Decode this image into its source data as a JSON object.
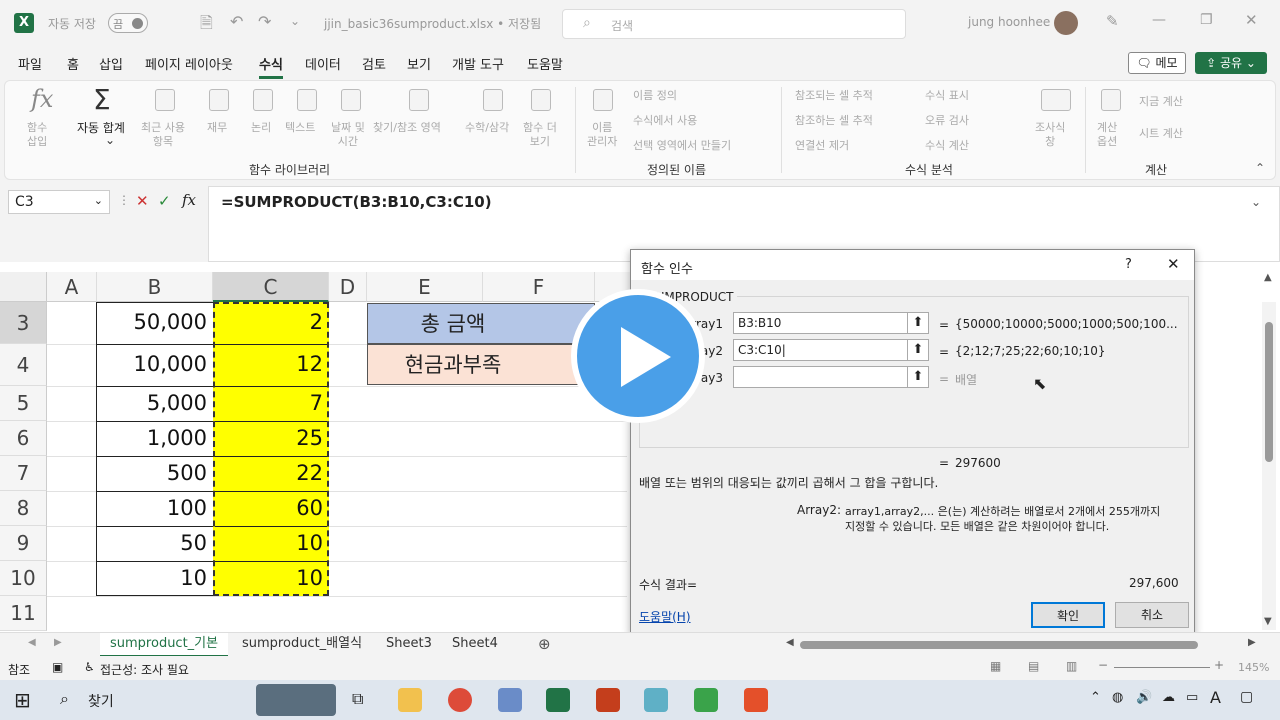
{
  "titlebar": {
    "autosave_label": "자동 저장",
    "autosave_state": "끔",
    "filename": "jjin_basic36sumproduct.xlsx • 저장됨",
    "search_placeholder": "검색",
    "user": "jung hoonhee"
  },
  "menu": [
    "파일",
    "홈",
    "삽입",
    "페이지 레이아웃",
    "수식",
    "데이터",
    "검토",
    "보기",
    "개발 도구",
    "도움말"
  ],
  "menu_active": "수식",
  "buttons": {
    "memo": "메모",
    "share": "공유"
  },
  "ribbon": {
    "func_library": {
      "label": "함수 라이브러리",
      "items": [
        "함수\n삽입",
        "자동 합계",
        "최근 사용\n항목",
        "재무",
        "논리",
        "텍스트",
        "날짜 및\n시간",
        "찾기/참조 영역",
        "수학/삼각",
        "함수 더\n보기"
      ]
    },
    "defined_names": {
      "label": "정의된 이름",
      "manager": "이름\n관리자",
      "items": [
        "이름 정의",
        "수식에서 사용",
        "선택 영역에서 만들기"
      ]
    },
    "auditing": {
      "label": "수식 분석",
      "items": [
        "참조되는 셀 추적",
        "참조하는 셀 추적",
        "연결선 제거",
        "수식 표시",
        "오류 검사",
        "수식 계산"
      ],
      "watch": "조사식\n창"
    },
    "calculation": {
      "label": "계산",
      "options": "계산\n옵션",
      "items": [
        "지금 계산",
        "시트 계산"
      ]
    }
  },
  "formula_bar": {
    "name_box": "C3",
    "formula": "=SUMPRODUCT(B3:B10,C3:C10)"
  },
  "columns": [
    "A",
    "B",
    "C",
    "D",
    "E",
    "F"
  ],
  "rows": [
    "3",
    "4",
    "5",
    "6",
    "7",
    "8",
    "9",
    "10",
    "11"
  ],
  "col_b": [
    "50,000",
    "10,000",
    "5,000",
    "1,000",
    "500",
    "100",
    "50",
    "10"
  ],
  "col_c": [
    "2",
    "12",
    "7",
    "25",
    "22",
    "60",
    "10",
    "10"
  ],
  "e3": "총 금액",
  "e4": "현금과부족",
  "dialog": {
    "title": "함수 인수",
    "help_icon": "?",
    "func": "SUMPRODUCT",
    "args": [
      {
        "name": "Array1",
        "value": "B3:B10",
        "result": "{50000;10000;5000;1000;500;100..."
      },
      {
        "name": "Array2",
        "value": "C3:C10",
        "result": "{2;12;7;25;22;60;10;10}"
      },
      {
        "name": "Array3",
        "value": "",
        "result": "배열"
      }
    ],
    "total": "297600",
    "description": "배열 또는 범위의 대응되는 값끼리 곱해서 그 합을 구합니다.",
    "arg_name": "Array2:",
    "arg_desc1": "array1,array2,... 은(는) 계산하려는 배열로서 2개에서 255개까지",
    "arg_desc2": "지정할 수 있습니다. 모든 배열은 같은 차원이어야 합니다.",
    "result_label": "수식 결과=",
    "result_value": "297,600",
    "help_link": "도움말(H)",
    "ok": "확인",
    "cancel": "취소"
  },
  "sheets": [
    "sumproduct_기본",
    "sumproduct_배열식",
    "Sheet3",
    "Sheet4"
  ],
  "status": {
    "mode": "참조",
    "accessibility": "접근성: 조사 필요",
    "zoom": "145%"
  },
  "taskbar": {
    "search": "찾기",
    "lang": "A"
  },
  "colors": {
    "accent": "#217346",
    "highlight": "#ffff00",
    "e3_fill": "#b4c6e7",
    "e4_fill": "#fbe2d5",
    "play": "#4a9fe8"
  }
}
